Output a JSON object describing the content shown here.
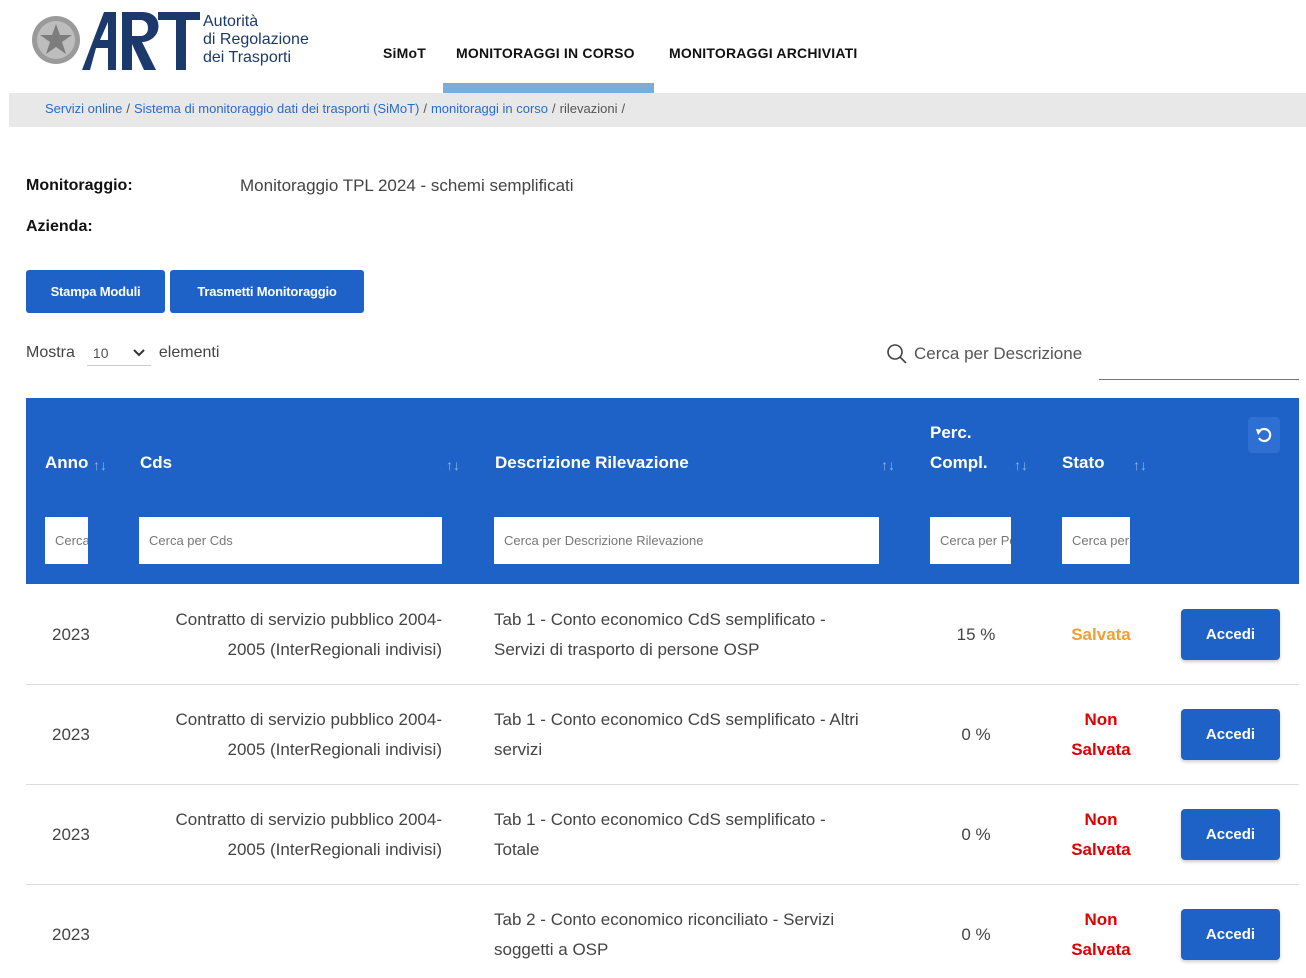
{
  "logo": {
    "letters": "ART",
    "line1": "Autorità",
    "line2": "di Regolazione",
    "line3": "dei Trasporti"
  },
  "nav": {
    "simot": "SiMoT",
    "in_corso": "MONITORAGGI IN CORSO",
    "archiviati": "MONITORAGGI ARCHIVIATI"
  },
  "breadcrumb": {
    "items": [
      "Servizi online",
      "Sistema di monitoraggio dati dei trasporti (SiMoT)",
      "monitoraggi in corso"
    ],
    "current": "rilevazioni",
    "sep": "/"
  },
  "meta": {
    "monitoraggio_label": "Monitoraggio:",
    "monitoraggio_value": "Monitoraggio TPL 2024 - schemi semplificati",
    "azienda_label": "Azienda:"
  },
  "buttons": {
    "stampa": "Stampa Moduli",
    "trasmetti": "Trasmetti Monitoraggio"
  },
  "length": {
    "prefix": "Mostra",
    "value": "10",
    "suffix": "elementi"
  },
  "search": {
    "placeholder": "Cerca per Descrizione"
  },
  "table": {
    "headers": {
      "anno": "Anno",
      "cds": "Cds",
      "desc": "Descrizione Rilevazione",
      "perc1": "Perc.",
      "perc2": "Compl.",
      "stato": "Stato"
    },
    "sort_glyph": "↑↓",
    "filters": {
      "anno": "Cerca per Anno",
      "cds": "Cerca per Cds",
      "desc": "Cerca per Descrizione Rilevazione",
      "perc": "Cerca per Perc. Compl.",
      "stato": "Cerca per Stato"
    },
    "action_label": "Accedi",
    "rows": [
      {
        "anno": "2023",
        "cds1": "Contratto di servizio pubblico 2004-",
        "cds2": "2005 (InterRegionali indivisi)",
        "desc1": "Tab 1 - Conto economico CdS semplificato -",
        "desc2": "Servizi di trasporto di persone OSP",
        "perc": "15 %",
        "stato1": "Salvata",
        "stato2": ""
      },
      {
        "anno": "2023",
        "cds1": "Contratto di servizio pubblico 2004-",
        "cds2": "2005 (InterRegionali indivisi)",
        "desc1": "Tab 1 - Conto economico CdS semplificato - Altri",
        "desc2": "servizi",
        "perc": "0 %",
        "stato1": "Non",
        "stato2": "Salvata"
      },
      {
        "anno": "2023",
        "cds1": "Contratto di servizio pubblico 2004-",
        "cds2": "2005 (InterRegionali indivisi)",
        "desc1": "Tab 1 - Conto economico CdS semplificato -",
        "desc2": "Totale",
        "perc": "0 %",
        "stato1": "Non",
        "stato2": "Salvata"
      },
      {
        "anno": "2023",
        "cds1": "",
        "cds2": "",
        "desc1": "Tab 2 - Conto economico riconciliato - Servizi",
        "desc2": "soggetti a OSP",
        "perc": "0 %",
        "stato1": "Non",
        "stato2": "Salvata"
      }
    ]
  },
  "colors": {
    "primary": "#1e62c7",
    "saved": "#f0a030",
    "not_saved": "#e00000",
    "nav_active": "#7aaed9"
  }
}
